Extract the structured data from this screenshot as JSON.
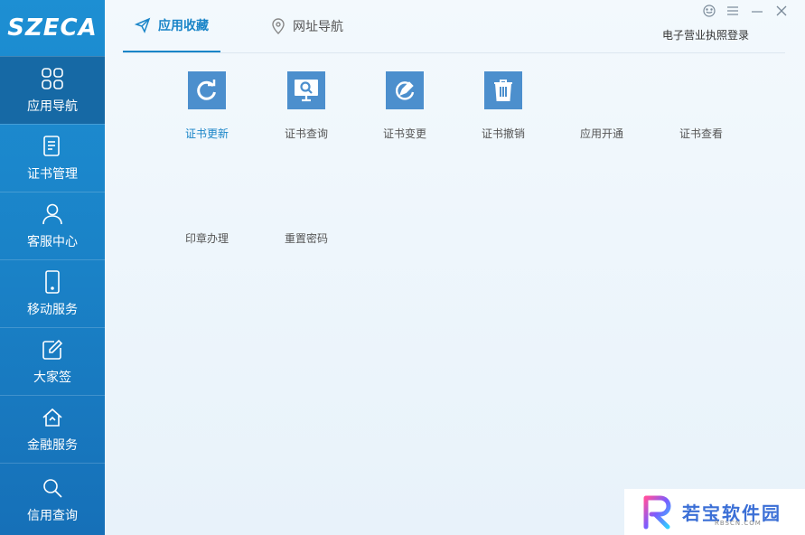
{
  "logo": {
    "text": "SZECA"
  },
  "sidebar": {
    "items": [
      {
        "label": "应用导航",
        "icon": "grid-icon",
        "active": true
      },
      {
        "label": "证书管理",
        "icon": "document-icon"
      },
      {
        "label": "客服中心",
        "icon": "user-icon"
      },
      {
        "label": "移动服务",
        "icon": "phone-icon"
      },
      {
        "label": "大家签",
        "icon": "edit-icon"
      },
      {
        "label": "金融服务",
        "icon": "home-icon"
      },
      {
        "label": "信用查询",
        "icon": "search-icon"
      }
    ]
  },
  "header": {
    "tabs": [
      {
        "label": "应用收藏",
        "icon": "send-icon",
        "active": true
      },
      {
        "label": "网址导航",
        "icon": "location-icon"
      }
    ],
    "license_login": "电子营业执照登录",
    "window_controls": [
      "feedback-icon",
      "menu-icon",
      "minimize-icon",
      "close-icon"
    ]
  },
  "apps": [
    {
      "label": "证书更新",
      "icon": "refresh-icon",
      "active": true
    },
    {
      "label": "证书查询",
      "icon": "monitor-search-icon"
    },
    {
      "label": "证书变更",
      "icon": "change-icon"
    },
    {
      "label": "证书撤销",
      "icon": "trash-icon"
    },
    {
      "label": "应用开通",
      "icon": ""
    },
    {
      "label": "证书查看",
      "icon": ""
    },
    {
      "label": "印章办理",
      "icon": ""
    },
    {
      "label": "重置密码",
      "icon": ""
    }
  ],
  "watermark": {
    "title": "若宝软件园",
    "subtitle": "RBSCN.COM"
  },
  "colors": {
    "sidebar": "#1a82c7",
    "sidebar_active": "#1669a5",
    "accent": "#1a85c8",
    "app_icon": "#4c8fcd"
  }
}
